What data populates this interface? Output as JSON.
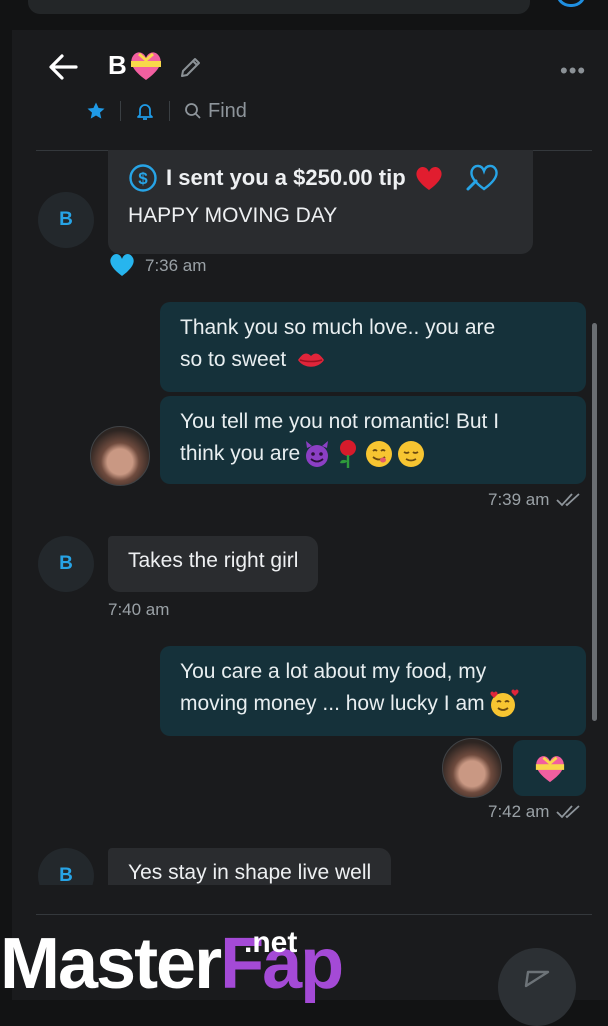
{
  "header": {
    "contact_name": "B",
    "find_label": "Find",
    "more_label": "•••",
    "back_icon": "arrow-left-icon",
    "edit_icon": "pencil-icon"
  },
  "messages": {
    "m1": {
      "avatar_initial": "B",
      "tip_text": "I sent you a $250.00 tip",
      "body": "HAPPY MOVING DAY",
      "time": "7:36 am"
    },
    "m2": {
      "line1": "Thank you so much love.. you are",
      "line2": "so to sweet"
    },
    "m3": {
      "line1": "You tell me you not romantic! But I",
      "line2": "think you are",
      "time": "7:39 am"
    },
    "m4": {
      "avatar_initial": "B",
      "body": "Takes the right girl",
      "time": "7:40 am"
    },
    "m5": {
      "line1": "You care a lot about my food, my",
      "line2": "moving money ... how lucky I am",
      "time": "7:42 am"
    },
    "m6": {
      "avatar_initial": "B",
      "body": "Yes stay in shape live well"
    }
  },
  "watermark": {
    "part1": "Master",
    "part2": "Fap",
    "domain": ".net"
  },
  "colors": {
    "accent": "#27a4e6",
    "outgoing_bubble": "#15313a",
    "incoming_bubble": "#2a2c2f",
    "watermark_fap": "#a44ad6"
  }
}
